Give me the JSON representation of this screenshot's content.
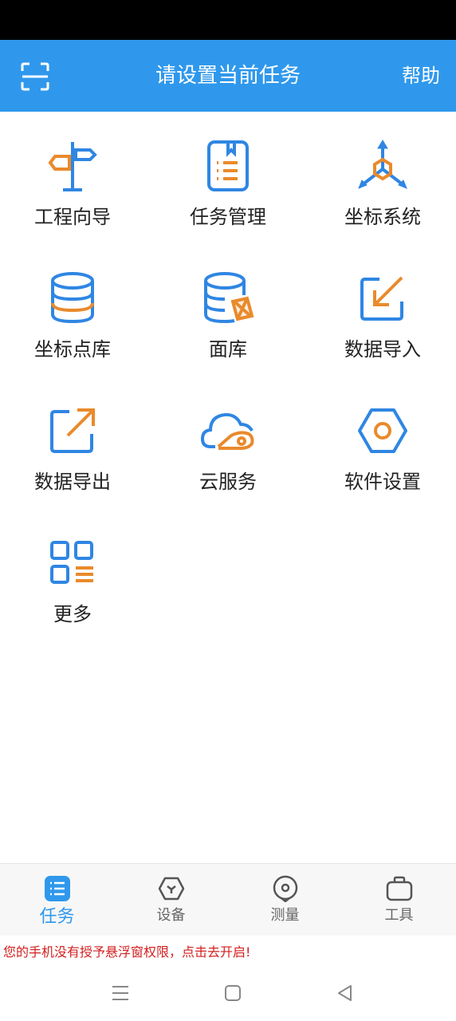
{
  "header": {
    "title": "请设置当前任务",
    "help_label": "帮助"
  },
  "tiles": [
    {
      "label": "工程向导",
      "icon": "signpost-icon"
    },
    {
      "label": "任务管理",
      "icon": "task-document-icon"
    },
    {
      "label": "坐标系统",
      "icon": "coordinate-axes-icon"
    },
    {
      "label": "坐标点库",
      "icon": "database-icon"
    },
    {
      "label": "面库",
      "icon": "database-surface-icon"
    },
    {
      "label": "数据导入",
      "icon": "import-icon"
    },
    {
      "label": "数据导出",
      "icon": "export-icon"
    },
    {
      "label": "云服务",
      "icon": "cloud-icon"
    },
    {
      "label": "软件设置",
      "icon": "settings-hex-icon"
    },
    {
      "label": "更多",
      "icon": "more-grid-icon"
    }
  ],
  "bottom_nav": [
    {
      "label": "任务",
      "icon": "task-list-icon",
      "active": true
    },
    {
      "label": "设备",
      "icon": "device-icon",
      "active": false
    },
    {
      "label": "测量",
      "icon": "measure-pin-icon",
      "active": false
    },
    {
      "label": "工具",
      "icon": "toolbox-icon",
      "active": false
    }
  ],
  "warning_text": "您的手机没有授予悬浮窗权限，点击去开启!",
  "colors": {
    "primary": "#2f98ec",
    "icon_blue": "#2f86e3",
    "icon_orange": "#e98a2b",
    "warning_red": "#d31f1f"
  }
}
